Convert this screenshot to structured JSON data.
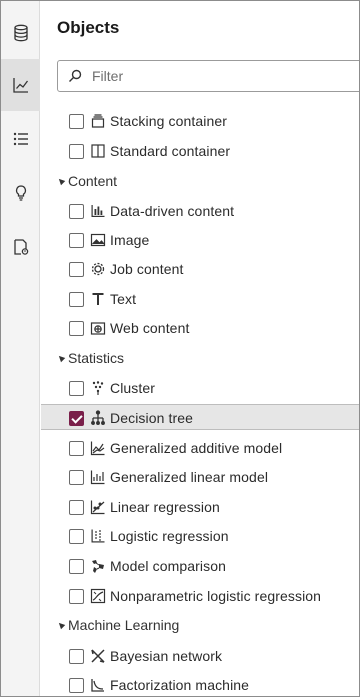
{
  "panel": {
    "title": "Objects",
    "search_placeholder": "Filter"
  },
  "rail": [
    {
      "name": "data-icon",
      "active": false
    },
    {
      "name": "objects-icon",
      "active": true
    },
    {
      "name": "outline-icon",
      "active": false
    },
    {
      "name": "suggestions-icon",
      "active": false
    },
    {
      "name": "page-options-icon",
      "active": false
    }
  ],
  "containers": {
    "items": [
      {
        "label": "Stacking container",
        "icon": "stacking-container-icon",
        "checked": false
      },
      {
        "label": "Standard container",
        "icon": "standard-container-icon",
        "checked": false
      }
    ]
  },
  "content": {
    "label": "Content",
    "items": [
      {
        "label": "Data-driven content",
        "icon": "data-driven-content-icon",
        "checked": false
      },
      {
        "label": "Image",
        "icon": "image-icon",
        "checked": false
      },
      {
        "label": "Job content",
        "icon": "job-content-icon",
        "checked": false
      },
      {
        "label": "Text",
        "icon": "text-icon",
        "checked": false
      },
      {
        "label": "Web content",
        "icon": "web-content-icon",
        "checked": false
      }
    ]
  },
  "statistics": {
    "label": "Statistics",
    "items": [
      {
        "label": "Cluster",
        "icon": "cluster-icon",
        "checked": false
      },
      {
        "label": "Decision tree",
        "icon": "decision-tree-icon",
        "checked": true
      },
      {
        "label": "Generalized additive model",
        "icon": "generalized-additive-model-icon",
        "checked": false
      },
      {
        "label": "Generalized linear model",
        "icon": "generalized-linear-model-icon",
        "checked": false
      },
      {
        "label": "Linear regression",
        "icon": "linear-regression-icon",
        "checked": false
      },
      {
        "label": "Logistic regression",
        "icon": "logistic-regression-icon",
        "checked": false
      },
      {
        "label": "Model comparison",
        "icon": "model-comparison-icon",
        "checked": false
      },
      {
        "label": "Nonparametric logistic regression",
        "icon": "nonparametric-logistic-regression-icon",
        "checked": false
      }
    ]
  },
  "machine_learning": {
    "label": "Machine Learning",
    "items": [
      {
        "label": "Bayesian network",
        "icon": "bayesian-network-icon",
        "checked": false
      },
      {
        "label": "Factorization machine",
        "icon": "factorization-machine-icon",
        "checked": false
      }
    ]
  },
  "colors": {
    "checked": "#7a1f4a",
    "selected_row": "#e6e6e6",
    "rail_bg": "#f4f4f4"
  }
}
